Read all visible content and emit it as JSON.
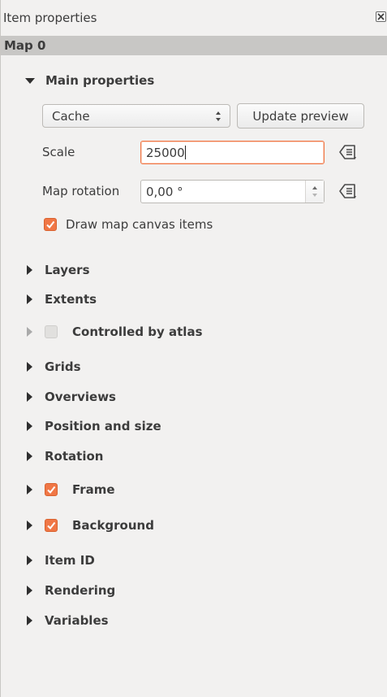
{
  "dock": {
    "title": "Item properties"
  },
  "item": {
    "name": "Map 0"
  },
  "main_properties": {
    "title": "Main properties",
    "expanded": true,
    "preview_mode": {
      "selected": "Cache"
    },
    "update_preview_label": "Update preview",
    "scale": {
      "label": "Scale",
      "value": "25000"
    },
    "rotation": {
      "label": "Map rotation",
      "value": "0,00 °"
    },
    "draw_canvas_items": {
      "label": "Draw map canvas items",
      "checked": true
    }
  },
  "sections": [
    {
      "id": "layers",
      "label": "Layers"
    },
    {
      "id": "extents",
      "label": "Extents"
    },
    {
      "id": "atlas",
      "label": "Controlled by atlas",
      "checkbox": true,
      "checked": false,
      "disabled": true
    },
    {
      "id": "grids",
      "label": "Grids"
    },
    {
      "id": "overviews",
      "label": "Overviews"
    },
    {
      "id": "position",
      "label": "Position and size"
    },
    {
      "id": "rotation",
      "label": "Rotation"
    },
    {
      "id": "frame",
      "label": "Frame",
      "checkbox": true,
      "checked": true
    },
    {
      "id": "background",
      "label": "Background",
      "checkbox": true,
      "checked": true
    },
    {
      "id": "item-id",
      "label": "Item ID"
    },
    {
      "id": "rendering",
      "label": "Rendering"
    },
    {
      "id": "variables",
      "label": "Variables"
    }
  ],
  "colors": {
    "accent": "#f07746",
    "header_bar": "#c8c7c5",
    "panel_bg": "#f2f1f0"
  },
  "icons": {
    "close": "close-icon",
    "expand": "triangle-right-icon",
    "collapse": "triangle-down-icon",
    "data_defined": "data-defined-override-icon",
    "checkmark": "checkmark-icon"
  }
}
